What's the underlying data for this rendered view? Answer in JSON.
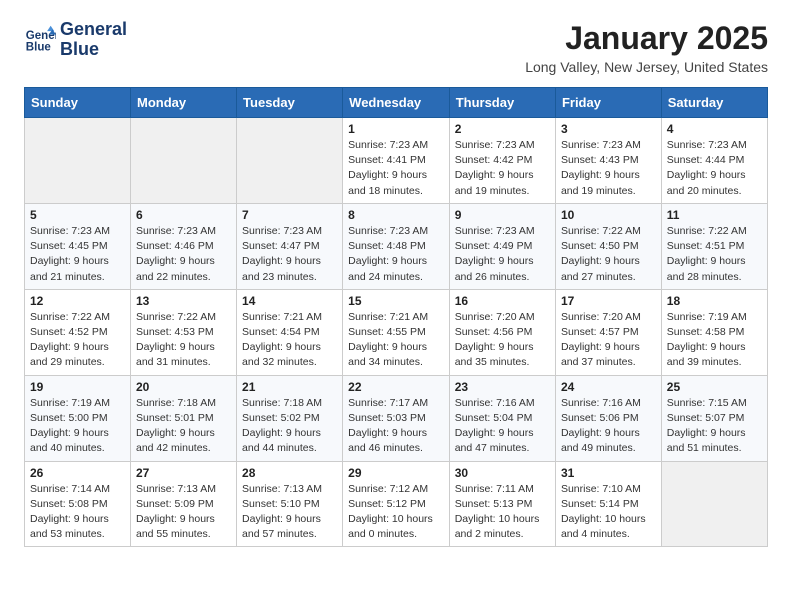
{
  "header": {
    "logo_line1": "General",
    "logo_line2": "Blue",
    "month_title": "January 2025",
    "location": "Long Valley, New Jersey, United States"
  },
  "weekdays": [
    "Sunday",
    "Monday",
    "Tuesday",
    "Wednesday",
    "Thursday",
    "Friday",
    "Saturday"
  ],
  "weeks": [
    [
      {
        "day": "",
        "sunrise": "",
        "sunset": "",
        "daylight": ""
      },
      {
        "day": "",
        "sunrise": "",
        "sunset": "",
        "daylight": ""
      },
      {
        "day": "",
        "sunrise": "",
        "sunset": "",
        "daylight": ""
      },
      {
        "day": "1",
        "sunrise": "Sunrise: 7:23 AM",
        "sunset": "Sunset: 4:41 PM",
        "daylight": "Daylight: 9 hours and 18 minutes."
      },
      {
        "day": "2",
        "sunrise": "Sunrise: 7:23 AM",
        "sunset": "Sunset: 4:42 PM",
        "daylight": "Daylight: 9 hours and 19 minutes."
      },
      {
        "day": "3",
        "sunrise": "Sunrise: 7:23 AM",
        "sunset": "Sunset: 4:43 PM",
        "daylight": "Daylight: 9 hours and 19 minutes."
      },
      {
        "day": "4",
        "sunrise": "Sunrise: 7:23 AM",
        "sunset": "Sunset: 4:44 PM",
        "daylight": "Daylight: 9 hours and 20 minutes."
      }
    ],
    [
      {
        "day": "5",
        "sunrise": "Sunrise: 7:23 AM",
        "sunset": "Sunset: 4:45 PM",
        "daylight": "Daylight: 9 hours and 21 minutes."
      },
      {
        "day": "6",
        "sunrise": "Sunrise: 7:23 AM",
        "sunset": "Sunset: 4:46 PM",
        "daylight": "Daylight: 9 hours and 22 minutes."
      },
      {
        "day": "7",
        "sunrise": "Sunrise: 7:23 AM",
        "sunset": "Sunset: 4:47 PM",
        "daylight": "Daylight: 9 hours and 23 minutes."
      },
      {
        "day": "8",
        "sunrise": "Sunrise: 7:23 AM",
        "sunset": "Sunset: 4:48 PM",
        "daylight": "Daylight: 9 hours and 24 minutes."
      },
      {
        "day": "9",
        "sunrise": "Sunrise: 7:23 AM",
        "sunset": "Sunset: 4:49 PM",
        "daylight": "Daylight: 9 hours and 26 minutes."
      },
      {
        "day": "10",
        "sunrise": "Sunrise: 7:22 AM",
        "sunset": "Sunset: 4:50 PM",
        "daylight": "Daylight: 9 hours and 27 minutes."
      },
      {
        "day": "11",
        "sunrise": "Sunrise: 7:22 AM",
        "sunset": "Sunset: 4:51 PM",
        "daylight": "Daylight: 9 hours and 28 minutes."
      }
    ],
    [
      {
        "day": "12",
        "sunrise": "Sunrise: 7:22 AM",
        "sunset": "Sunset: 4:52 PM",
        "daylight": "Daylight: 9 hours and 29 minutes."
      },
      {
        "day": "13",
        "sunrise": "Sunrise: 7:22 AM",
        "sunset": "Sunset: 4:53 PM",
        "daylight": "Daylight: 9 hours and 31 minutes."
      },
      {
        "day": "14",
        "sunrise": "Sunrise: 7:21 AM",
        "sunset": "Sunset: 4:54 PM",
        "daylight": "Daylight: 9 hours and 32 minutes."
      },
      {
        "day": "15",
        "sunrise": "Sunrise: 7:21 AM",
        "sunset": "Sunset: 4:55 PM",
        "daylight": "Daylight: 9 hours and 34 minutes."
      },
      {
        "day": "16",
        "sunrise": "Sunrise: 7:20 AM",
        "sunset": "Sunset: 4:56 PM",
        "daylight": "Daylight: 9 hours and 35 minutes."
      },
      {
        "day": "17",
        "sunrise": "Sunrise: 7:20 AM",
        "sunset": "Sunset: 4:57 PM",
        "daylight": "Daylight: 9 hours and 37 minutes."
      },
      {
        "day": "18",
        "sunrise": "Sunrise: 7:19 AM",
        "sunset": "Sunset: 4:58 PM",
        "daylight": "Daylight: 9 hours and 39 minutes."
      }
    ],
    [
      {
        "day": "19",
        "sunrise": "Sunrise: 7:19 AM",
        "sunset": "Sunset: 5:00 PM",
        "daylight": "Daylight: 9 hours and 40 minutes."
      },
      {
        "day": "20",
        "sunrise": "Sunrise: 7:18 AM",
        "sunset": "Sunset: 5:01 PM",
        "daylight": "Daylight: 9 hours and 42 minutes."
      },
      {
        "day": "21",
        "sunrise": "Sunrise: 7:18 AM",
        "sunset": "Sunset: 5:02 PM",
        "daylight": "Daylight: 9 hours and 44 minutes."
      },
      {
        "day": "22",
        "sunrise": "Sunrise: 7:17 AM",
        "sunset": "Sunset: 5:03 PM",
        "daylight": "Daylight: 9 hours and 46 minutes."
      },
      {
        "day": "23",
        "sunrise": "Sunrise: 7:16 AM",
        "sunset": "Sunset: 5:04 PM",
        "daylight": "Daylight: 9 hours and 47 minutes."
      },
      {
        "day": "24",
        "sunrise": "Sunrise: 7:16 AM",
        "sunset": "Sunset: 5:06 PM",
        "daylight": "Daylight: 9 hours and 49 minutes."
      },
      {
        "day": "25",
        "sunrise": "Sunrise: 7:15 AM",
        "sunset": "Sunset: 5:07 PM",
        "daylight": "Daylight: 9 hours and 51 minutes."
      }
    ],
    [
      {
        "day": "26",
        "sunrise": "Sunrise: 7:14 AM",
        "sunset": "Sunset: 5:08 PM",
        "daylight": "Daylight: 9 hours and 53 minutes."
      },
      {
        "day": "27",
        "sunrise": "Sunrise: 7:13 AM",
        "sunset": "Sunset: 5:09 PM",
        "daylight": "Daylight: 9 hours and 55 minutes."
      },
      {
        "day": "28",
        "sunrise": "Sunrise: 7:13 AM",
        "sunset": "Sunset: 5:10 PM",
        "daylight": "Daylight: 9 hours and 57 minutes."
      },
      {
        "day": "29",
        "sunrise": "Sunrise: 7:12 AM",
        "sunset": "Sunset: 5:12 PM",
        "daylight": "Daylight: 10 hours and 0 minutes."
      },
      {
        "day": "30",
        "sunrise": "Sunrise: 7:11 AM",
        "sunset": "Sunset: 5:13 PM",
        "daylight": "Daylight: 10 hours and 2 minutes."
      },
      {
        "day": "31",
        "sunrise": "Sunrise: 7:10 AM",
        "sunset": "Sunset: 5:14 PM",
        "daylight": "Daylight: 10 hours and 4 minutes."
      },
      {
        "day": "",
        "sunrise": "",
        "sunset": "",
        "daylight": ""
      }
    ]
  ]
}
